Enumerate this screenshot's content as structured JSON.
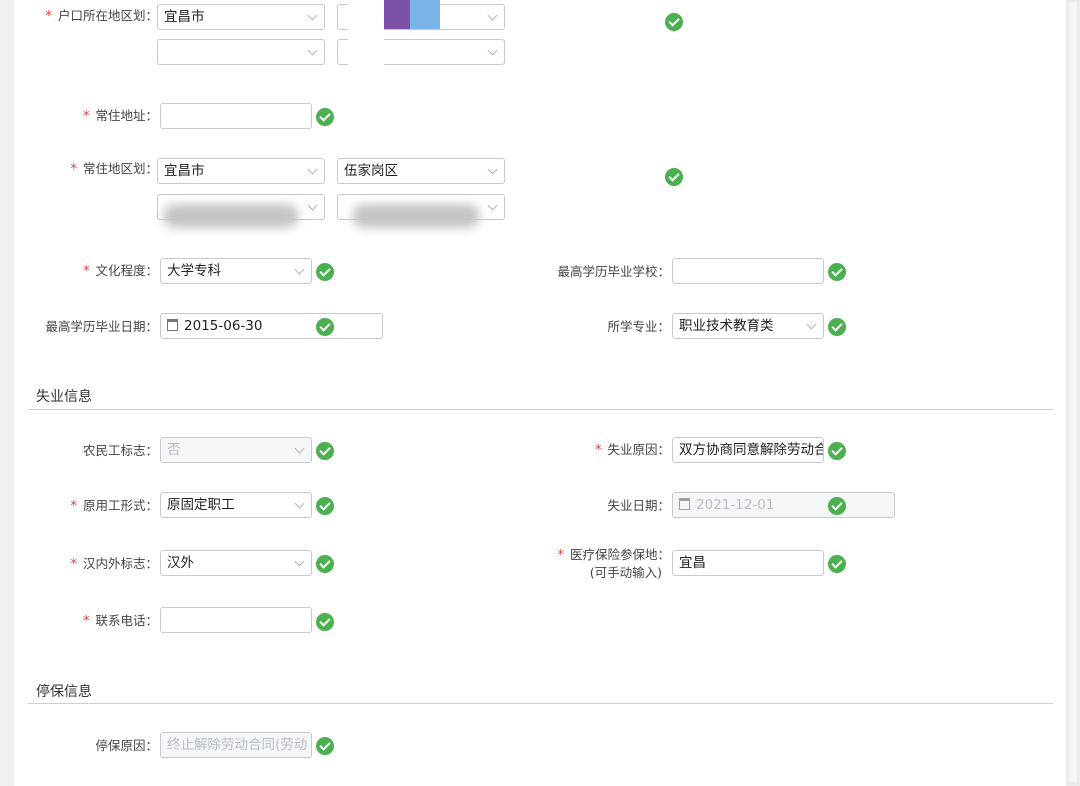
{
  "form": {
    "hukou_region": {
      "label": "户口所在地区划：",
      "city": "宜昌市"
    },
    "residence_address": {
      "label": "常住地址："
    },
    "residence_region": {
      "label": "常住地区划：",
      "city": "宜昌市",
      "district": "伍家岗区"
    },
    "education": {
      "label": "文化程度：",
      "value": "大学专科"
    },
    "school": {
      "label": "最高学历毕业学校："
    },
    "grad_date": {
      "label": "最高学历毕业日期：",
      "value": "2015-06-30"
    },
    "major": {
      "label": "所学专业：",
      "value": "职业技术教育类"
    }
  },
  "unemployment": {
    "title": "失业信息",
    "migrant": {
      "label": "农民工标志：",
      "value": "否"
    },
    "reason": {
      "label": "失业原因：",
      "value": "双方协商同意解除劳动合同"
    },
    "employment_form": {
      "label": "原用工形式：",
      "value": "原固定职工"
    },
    "date": {
      "label": "失业日期：",
      "value": "2021-12-01"
    },
    "han": {
      "label": "汉内外标志：",
      "value": "汉外"
    },
    "insurance_place": {
      "label": "医疗保险参保地：",
      "hint": "(可手动输入)",
      "value": "宜昌"
    },
    "phone": {
      "label": "联系电话："
    }
  },
  "suspension": {
    "title": "停保信息",
    "reason": {
      "label": "停保原因：",
      "value": "终止解除劳动合同(劳动"
    }
  },
  "colors": {
    "required": "#e53935",
    "valid": "#4caf50"
  }
}
